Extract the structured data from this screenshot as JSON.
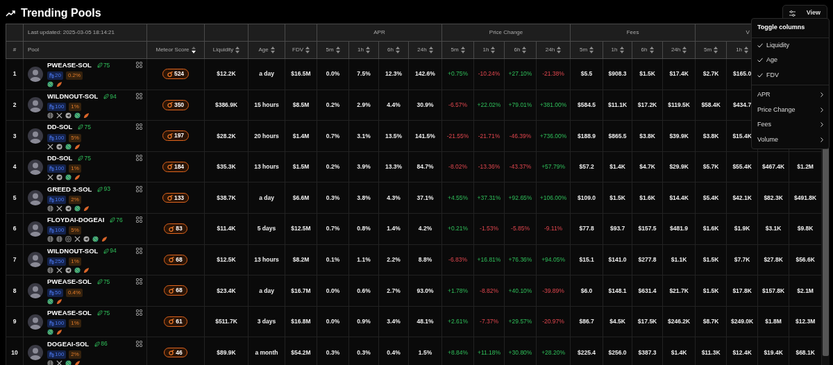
{
  "header": {
    "title": "Trending Pools",
    "view_button": "View"
  },
  "table": {
    "last_updated": "Last updated: 2025-03-05 18:14:21",
    "columns": [
      {
        "label": "#"
      },
      {
        "label": "Pool"
      },
      {
        "label": "Meteor Score",
        "sorted": true
      },
      {
        "label": "Liquidity",
        "sorted": false
      },
      {
        "label": "Age",
        "sorted": false
      },
      {
        "label": "FDV",
        "sorted": false
      }
    ],
    "groups": [
      {
        "label": "APR",
        "columns": [
          {
            "label": "5m",
            "sorted": false
          },
          {
            "label": "1h",
            "sorted": false
          },
          {
            "label": "6h",
            "sorted": false
          },
          {
            "label": "24h",
            "sorted": false
          }
        ]
      },
      {
        "label": "Price Change",
        "columns": [
          {
            "label": "5m",
            "sorted": false
          },
          {
            "label": "1h",
            "sorted": false
          },
          {
            "label": "6h",
            "sorted": false
          },
          {
            "label": "24h",
            "sorted": false
          }
        ]
      },
      {
        "label": "Fees",
        "columns": [
          {
            "label": "5m",
            "sorted": false
          },
          {
            "label": "1h",
            "sorted": false
          },
          {
            "label": "6h",
            "sorted": false
          },
          {
            "label": "24h",
            "sorted": false
          }
        ]
      },
      {
        "label": "V",
        "columns": [
          {
            "label": "5m",
            "sorted": false
          },
          {
            "label": "1h",
            "sorted": false
          }
        ]
      }
    ],
    "rows": [
      {
        "rank": "1",
        "name": "PWEASE-SOL",
        "score": "75",
        "bin_step": "20",
        "fee": "0.2%",
        "links": [
          {
            "kind": "jupiter"
          },
          {
            "kind": "meteora"
          }
        ],
        "meteor_score": "524",
        "liquidity": "$12.2K",
        "age": "a day",
        "fdv": "$16.5M",
        "apr": [
          "0.0%",
          "7.5%",
          "12.3%",
          "142.6%"
        ],
        "price_change": [
          {
            "value": "+0.75%",
            "positive": true
          },
          {
            "value": "-10.24%",
            "positive": false
          },
          {
            "value": "+27.10%",
            "positive": true
          },
          {
            "value": "-21.38%",
            "positive": false
          }
        ],
        "fees": [
          "$5.5",
          "$908.3",
          "$1.5K",
          "$17.4K"
        ],
        "volume": [
          "$2.7K",
          "$165.0"
        ]
      },
      {
        "rank": "2",
        "name": "WILDNOUT-SOL",
        "score": "94",
        "bin_step": "100",
        "fee": "1%",
        "links": [
          {
            "kind": "web"
          },
          {
            "kind": "x"
          },
          {
            "kind": "telegram"
          },
          {
            "kind": "jupiter"
          },
          {
            "kind": "meteora"
          }
        ],
        "meteor_score": "350",
        "liquidity": "$386.9K",
        "age": "15 hours",
        "fdv": "$8.5M",
        "apr": [
          "0.2%",
          "2.9%",
          "4.4%",
          "30.9%"
        ],
        "price_change": [
          {
            "value": "-6.57%",
            "positive": false
          },
          {
            "value": "+22.02%",
            "positive": true
          },
          {
            "value": "+79.01%",
            "positive": true
          },
          {
            "value": "+381.00%",
            "positive": true
          }
        ],
        "fees": [
          "$584.5",
          "$11.1K",
          "$17.2K",
          "$119.5K"
        ],
        "volume": [
          "$58.4K",
          "$434.7"
        ]
      },
      {
        "rank": "3",
        "name": "DD-SOL",
        "score": "75",
        "bin_step": "100",
        "fee": "5%",
        "links": [
          {
            "kind": "x"
          },
          {
            "kind": "telegram"
          },
          {
            "kind": "jupiter"
          },
          {
            "kind": "meteora"
          }
        ],
        "meteor_score": "197",
        "liquidity": "$28.2K",
        "age": "20 hours",
        "fdv": "$1.4M",
        "apr": [
          "0.7%",
          "3.1%",
          "13.5%",
          "141.5%"
        ],
        "price_change": [
          {
            "value": "-21.55%",
            "positive": false
          },
          {
            "value": "-21.71%",
            "positive": false
          },
          {
            "value": "-46.39%",
            "positive": false
          },
          {
            "value": "+736.00%",
            "positive": true
          }
        ],
        "fees": [
          "$188.9",
          "$865.5",
          "$3.8K",
          "$39.9K"
        ],
        "volume": [
          "$3.8K",
          "$15.4K"
        ]
      },
      {
        "rank": "4",
        "name": "DD-SOL",
        "score": "75",
        "bin_step": "100",
        "fee": "1%",
        "links": [
          {
            "kind": "x"
          },
          {
            "kind": "telegram"
          },
          {
            "kind": "jupiter"
          },
          {
            "kind": "meteora"
          }
        ],
        "meteor_score": "184",
        "liquidity": "$35.3K",
        "age": "13 hours",
        "fdv": "$1.5M",
        "apr": [
          "0.2%",
          "3.9%",
          "13.3%",
          "84.7%"
        ],
        "price_change": [
          {
            "value": "-8.02%",
            "positive": false
          },
          {
            "value": "-13.36%",
            "positive": false
          },
          {
            "value": "-43.37%",
            "positive": false
          },
          {
            "value": "+57.79%",
            "positive": true
          }
        ],
        "fees": [
          "$57.2",
          "$1.4K",
          "$4.7K",
          "$29.9K"
        ],
        "volume": [
          "$5.7K",
          "$55.4K",
          "$467.4K",
          "$1.2M"
        ]
      },
      {
        "rank": "5",
        "name": "GREED 3-SOL",
        "score": "93",
        "bin_step": "100",
        "fee": "2%",
        "links": [
          {
            "kind": "web"
          },
          {
            "kind": "x"
          },
          {
            "kind": "telegram"
          },
          {
            "kind": "jupiter"
          },
          {
            "kind": "meteora"
          }
        ],
        "meteor_score": "133",
        "liquidity": "$38.7K",
        "age": "a day",
        "fdv": "$6.6M",
        "apr": [
          "0.3%",
          "3.8%",
          "4.3%",
          "37.1%"
        ],
        "price_change": [
          {
            "value": "+4.55%",
            "positive": true
          },
          {
            "value": "+37.31%",
            "positive": true
          },
          {
            "value": "+92.65%",
            "positive": true
          },
          {
            "value": "+106.00%",
            "positive": true
          }
        ],
        "fees": [
          "$109.0",
          "$1.5K",
          "$1.6K",
          "$14.4K"
        ],
        "volume": [
          "$5.4K",
          "$42.1K",
          "$82.3K",
          "$491.8K"
        ]
      },
      {
        "rank": "6",
        "name": "FLOYDAI-DOGEAI",
        "score": "76",
        "bin_step": "100",
        "fee": "5%",
        "links": [
          {
            "kind": "web"
          },
          {
            "kind": "web"
          },
          {
            "kind": "instagram"
          },
          {
            "kind": "x"
          },
          {
            "kind": "telegram"
          },
          {
            "kind": "jupiter"
          },
          {
            "kind": "meteora"
          }
        ],
        "meteor_score": "83",
        "liquidity": "$11.4K",
        "age": "5 days",
        "fdv": "$12.5M",
        "apr": [
          "0.7%",
          "0.8%",
          "1.4%",
          "4.2%"
        ],
        "price_change": [
          {
            "value": "+0.21%",
            "positive": true
          },
          {
            "value": "-1.53%",
            "positive": false
          },
          {
            "value": "-5.85%",
            "positive": false
          },
          {
            "value": "-9.11%",
            "positive": false
          }
        ],
        "fees": [
          "$77.8",
          "$93.7",
          "$157.5",
          "$481.9"
        ],
        "volume": [
          "$1.6K",
          "$1.9K",
          "$3.1K",
          "$9.8K"
        ]
      },
      {
        "rank": "7",
        "name": "WILDNOUT-SOL",
        "score": "94",
        "bin_step": "250",
        "fee": "1%",
        "links": [
          {
            "kind": "web"
          },
          {
            "kind": "x"
          },
          {
            "kind": "telegram"
          },
          {
            "kind": "jupiter"
          },
          {
            "kind": "meteora"
          }
        ],
        "meteor_score": "68",
        "liquidity": "$12.5K",
        "age": "13 hours",
        "fdv": "$8.2M",
        "apr": [
          "0.1%",
          "1.1%",
          "2.2%",
          "8.8%"
        ],
        "price_change": [
          {
            "value": "-6.83%",
            "positive": false
          },
          {
            "value": "+16.81%",
            "positive": true
          },
          {
            "value": "+76.36%",
            "positive": true
          },
          {
            "value": "+94.05%",
            "positive": true
          }
        ],
        "fees": [
          "$15.1",
          "$141.0",
          "$277.8",
          "$1.1K"
        ],
        "volume": [
          "$1.5K",
          "$7.7K",
          "$27.8K",
          "$56.6K"
        ]
      },
      {
        "rank": "8",
        "name": "PWEASE-SOL",
        "score": "75",
        "bin_step": "50",
        "fee": "0.4%",
        "links": [
          {
            "kind": "jupiter"
          },
          {
            "kind": "meteora"
          }
        ],
        "meteor_score": "68",
        "liquidity": "$23.4K",
        "age": "a day",
        "fdv": "$16.7M",
        "apr": [
          "0.0%",
          "0.6%",
          "2.7%",
          "93.0%"
        ],
        "price_change": [
          {
            "value": "+1.78%",
            "positive": true
          },
          {
            "value": "-8.82%",
            "positive": false
          },
          {
            "value": "+40.10%",
            "positive": true
          },
          {
            "value": "-39.89%",
            "positive": false
          }
        ],
        "fees": [
          "$6.0",
          "$148.1",
          "$631.4",
          "$21.7K"
        ],
        "volume": [
          "$1.5K",
          "$17.8K",
          "$157.8K",
          "$2.1M"
        ]
      },
      {
        "rank": "9",
        "name": "PWEASE-SOL",
        "score": "75",
        "bin_step": "100",
        "fee": "1%",
        "links": [
          {
            "kind": "jupiter"
          },
          {
            "kind": "meteora"
          }
        ],
        "meteor_score": "61",
        "liquidity": "$511.7K",
        "age": "3 days",
        "fdv": "$16.8M",
        "apr": [
          "0.0%",
          "0.9%",
          "3.4%",
          "48.1%"
        ],
        "price_change": [
          {
            "value": "+2.61%",
            "positive": true
          },
          {
            "value": "-7.37%",
            "positive": false
          },
          {
            "value": "+29.57%",
            "positive": true
          },
          {
            "value": "-20.97%",
            "positive": false
          }
        ],
        "fees": [
          "$86.7",
          "$4.5K",
          "$17.5K",
          "$246.2K"
        ],
        "volume": [
          "$8.7K",
          "$249.0K",
          "$1.8M",
          "$12.3M"
        ]
      },
      {
        "rank": "10",
        "name": "DOGEAI-SOL",
        "score": "86",
        "bin_step": "100",
        "fee": "2%",
        "links": [
          {
            "kind": "web"
          },
          {
            "kind": "x"
          },
          {
            "kind": "jupiter"
          },
          {
            "kind": "meteora"
          }
        ],
        "meteor_score": "46",
        "liquidity": "$89.9K",
        "age": "a month",
        "fdv": "$54.2M",
        "apr": [
          "0.3%",
          "0.3%",
          "0.4%",
          "1.5%"
        ],
        "price_change": [
          {
            "value": "+8.84%",
            "positive": true
          },
          {
            "value": "+11.18%",
            "positive": true
          },
          {
            "value": "+30.80%",
            "positive": true
          },
          {
            "value": "+28.20%",
            "positive": true
          }
        ],
        "fees": [
          "$225.4",
          "$256.0",
          "$387.3",
          "$1.4K"
        ],
        "volume": [
          "$11.3K",
          "$12.4K",
          "$19.4K",
          "$68.1K"
        ]
      }
    ]
  },
  "menu": {
    "title": "Toggle columns",
    "items": [
      {
        "kind": "toggle",
        "label": "Liquidity",
        "checked": true
      },
      {
        "kind": "toggle",
        "label": "Age",
        "checked": true
      },
      {
        "kind": "toggle",
        "label": "FDV",
        "checked": true
      },
      {
        "kind": "submenu",
        "label": "APR"
      },
      {
        "kind": "submenu",
        "label": "Price Change"
      },
      {
        "kind": "submenu",
        "label": "Fees"
      },
      {
        "kind": "submenu",
        "label": "Volume"
      }
    ]
  }
}
